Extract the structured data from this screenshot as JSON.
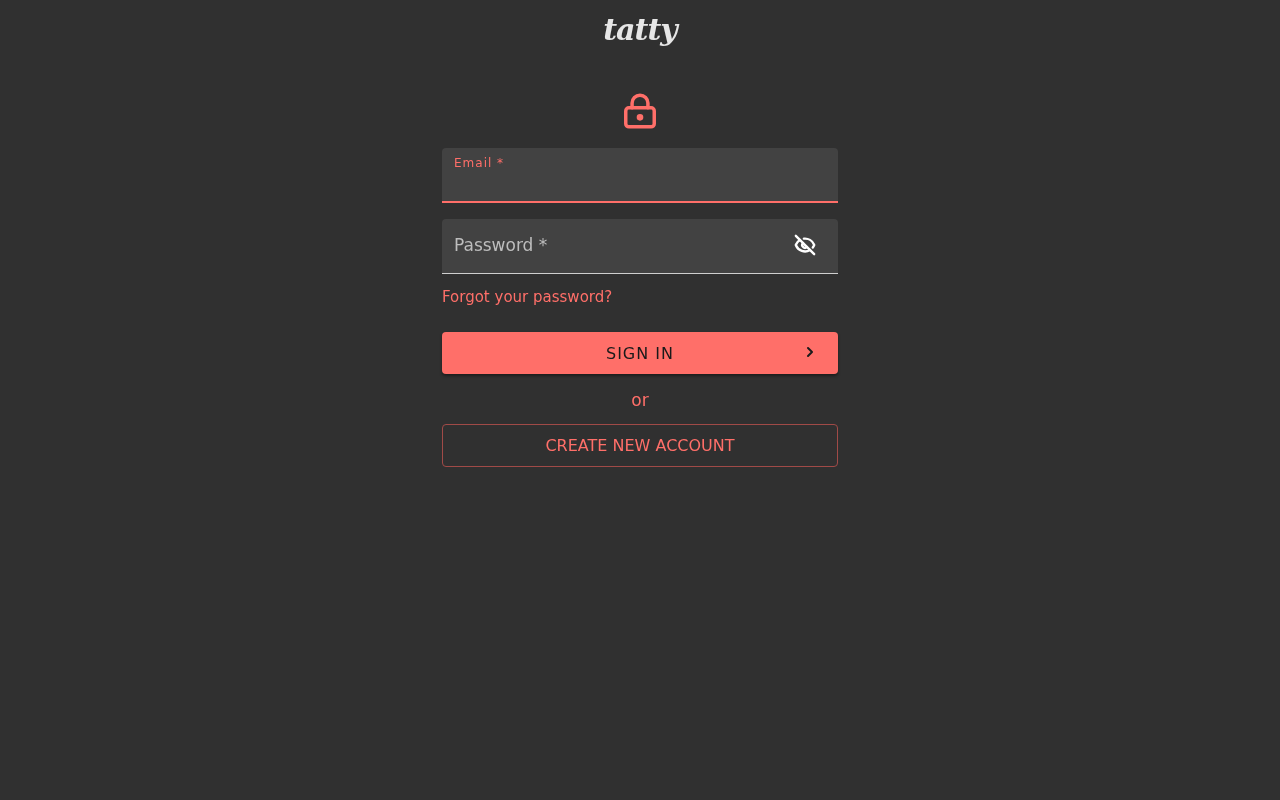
{
  "logo": "tatty",
  "fields": [
    {
      "label": "Email *",
      "focused": true,
      "password_toggle": false
    },
    {
      "label": "Password *",
      "focused": false,
      "password_toggle": true
    }
  ],
  "forgot_link": "Forgot your password?",
  "sign_in_button": "SIGN IN",
  "separator": "or",
  "create_account_button": "CREATE NEW ACCOUNT"
}
